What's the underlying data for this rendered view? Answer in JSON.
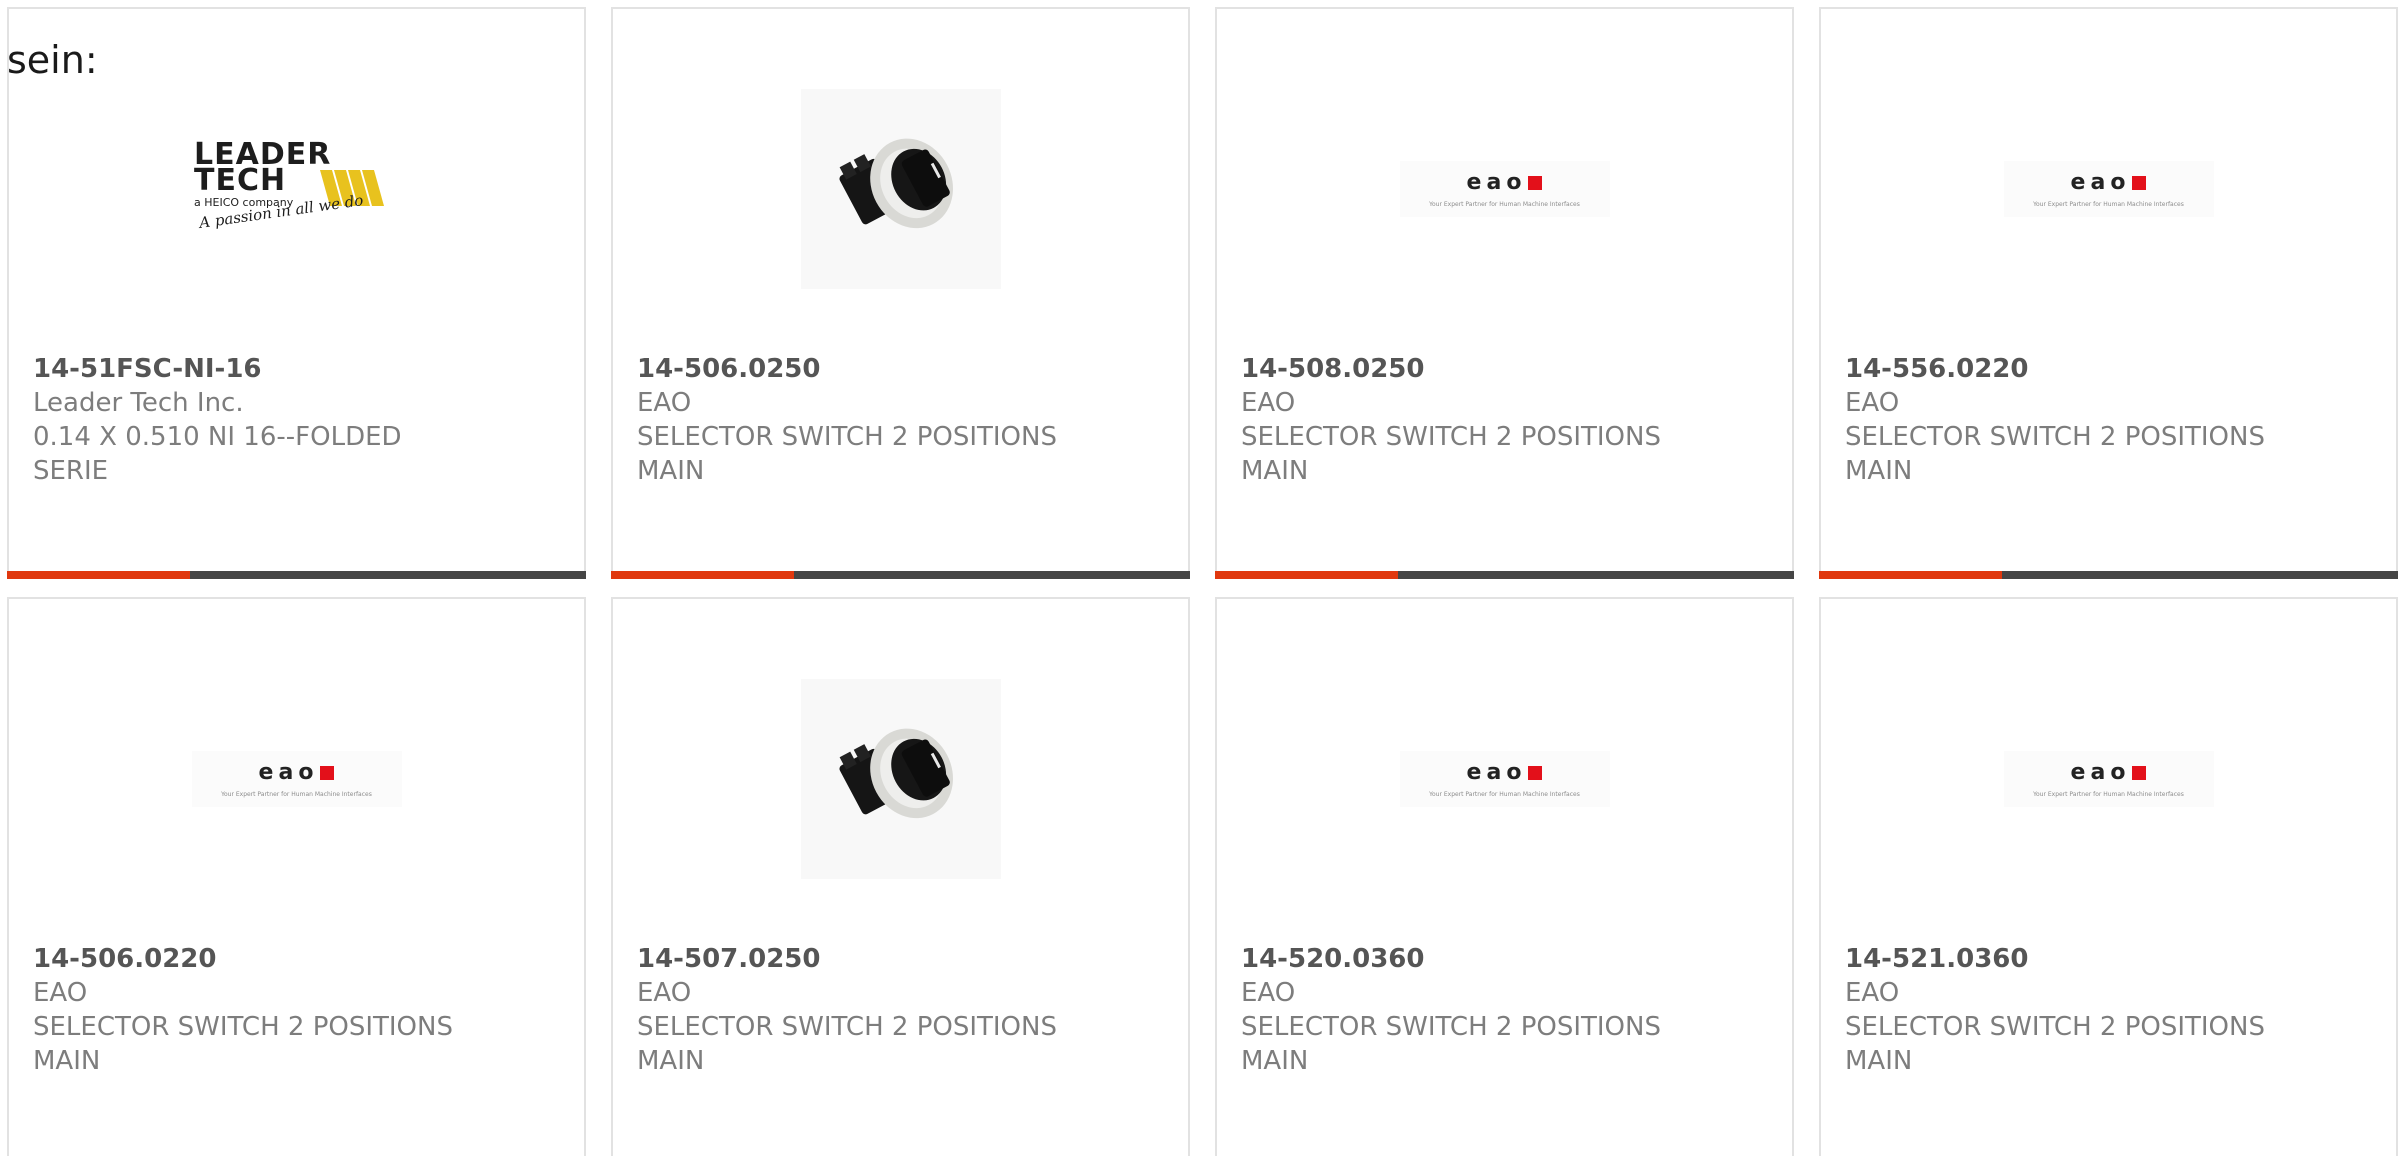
{
  "heading": "sein:",
  "products": [
    {
      "part_number": "14-51FSC-NI-16",
      "manufacturer": "Leader Tech Inc.",
      "desc_line1": "0.14 X 0.510 NI 16--FOLDED",
      "desc_line2": "SERIE",
      "image": "leader-tech-logo",
      "logo_text_1": "LEADER",
      "logo_text_2": "TECH",
      "logo_sub": "a HEICO company",
      "logo_slogan": "A passion in all we do"
    },
    {
      "part_number": "14-506.0250",
      "manufacturer": "EAO",
      "desc_line1": "SELECTOR SWITCH 2 POSITIONS",
      "desc_line2": "MAIN",
      "image": "selector-switch-photo"
    },
    {
      "part_number": "14-508.0250",
      "manufacturer": "EAO",
      "desc_line1": "SELECTOR SWITCH 2 POSITIONS",
      "desc_line2": "MAIN",
      "image": "eao-logo"
    },
    {
      "part_number": "14-556.0220",
      "manufacturer": "EAO",
      "desc_line1": "SELECTOR SWITCH 2 POSITIONS",
      "desc_line2": "MAIN",
      "image": "eao-logo"
    },
    {
      "part_number": "14-506.0220",
      "manufacturer": "EAO",
      "desc_line1": "SELECTOR SWITCH 2 POSITIONS",
      "desc_line2": "MAIN",
      "image": "eao-logo"
    },
    {
      "part_number": "14-507.0250",
      "manufacturer": "EAO",
      "desc_line1": "SELECTOR SWITCH 2 POSITIONS",
      "desc_line2": "MAIN",
      "image": "selector-switch-photo"
    },
    {
      "part_number": "14-520.0360",
      "manufacturer": "EAO",
      "desc_line1": "SELECTOR SWITCH 2 POSITIONS",
      "desc_line2": "MAIN",
      "image": "eao-logo"
    },
    {
      "part_number": "14-521.0360",
      "manufacturer": "EAO",
      "desc_line1": "SELECTOR SWITCH 2 POSITIONS",
      "desc_line2": "MAIN",
      "image": "eao-logo"
    }
  ],
  "eao_logo": {
    "word": "eao",
    "tagline": "Your Expert Partner for Human Machine Interfaces"
  },
  "colors": {
    "accent": "#e0380e",
    "bar_dark": "#454545",
    "border": "#e2e2e2",
    "text_muted": "#7d7d7d",
    "eao_red": "#e3101a",
    "leader_yellow": "#e8c21e"
  }
}
